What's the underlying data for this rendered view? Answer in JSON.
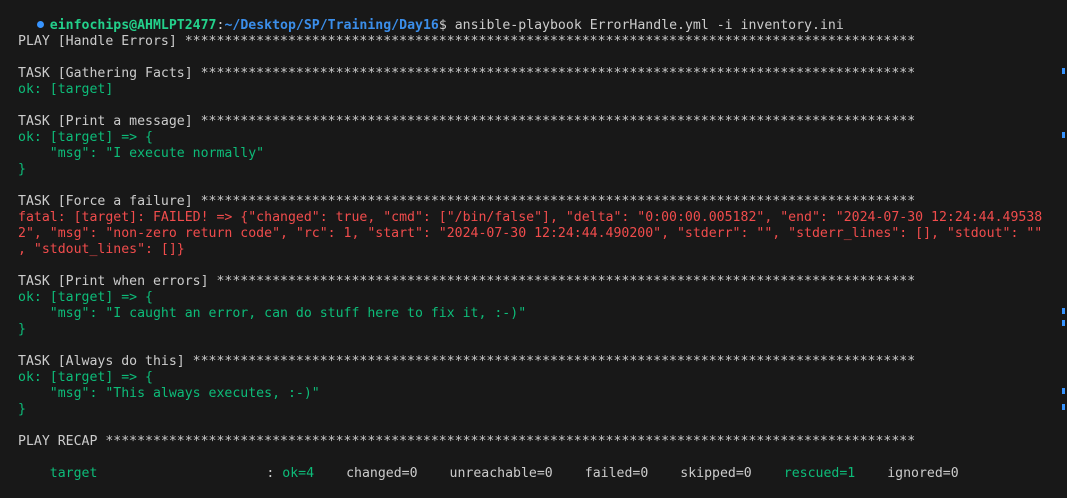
{
  "prompt": {
    "user_host": "einfochips@AHMLPT2477",
    "separator": ":",
    "path": "~/Desktop/SP/Training/Day16",
    "symbol": "$",
    "command": " ansible-playbook ErrorHandle.yml -i inventory.ini"
  },
  "output": {
    "play_header": "PLAY [Handle Errors] ********************************************************************************************",
    "task1_header": "TASK [Gathering Facts] ******************************************************************************************",
    "task1_result": "ok: [target]",
    "task2_header": "TASK [Print a message] ******************************************************************************************",
    "task2_result": "ok: [target] => {",
    "task2_msg": "    \"msg\": \"I execute normally\"",
    "task2_close": "}",
    "task3_header": "TASK [Force a failure] ******************************************************************************************",
    "task3_line1": "fatal: [target]: FAILED! => {\"changed\": true, \"cmd\": [\"/bin/false\"], \"delta\": \"0:00:00.005182\", \"end\": \"2024-07-30 12:24:44.49538",
    "task3_line2": "2\", \"msg\": \"non-zero return code\", \"rc\": 1, \"start\": \"2024-07-30 12:24:44.490200\", \"stderr\": \"\", \"stderr_lines\": [], \"stdout\": \"\"",
    "task3_line3": ", \"stdout_lines\": []}",
    "task4_header": "TASK [Print when errors] ****************************************************************************************",
    "task4_result": "ok: [target] => {",
    "task4_msg": "    \"msg\": \"I caught an error, can do stuff here to fix it, :-)\"",
    "task4_close": "}",
    "task5_header": "TASK [Always do this] *******************************************************************************************",
    "task5_result": "ok: [target] => {",
    "task5_msg": "    \"msg\": \"This always executes, :-)\"",
    "task5_close": "}",
    "recap_header": "PLAY RECAP ******************************************************************************************************"
  },
  "recap": {
    "host": "target",
    "colon": ": ",
    "ok": "ok=4",
    "changed": "changed=0",
    "unreachable": "unreachable=0",
    "failed": "failed=0",
    "skipped": "skipped=0",
    "rescued": "rescued=1",
    "ignored": "ignored=0"
  },
  "colors": {
    "background": "#181818",
    "text": "#cccccc",
    "ok_green": "#0dbc79",
    "fail_red": "#f14c4c",
    "user_green": "#23d18b",
    "path_blue": "#3b8eea"
  }
}
